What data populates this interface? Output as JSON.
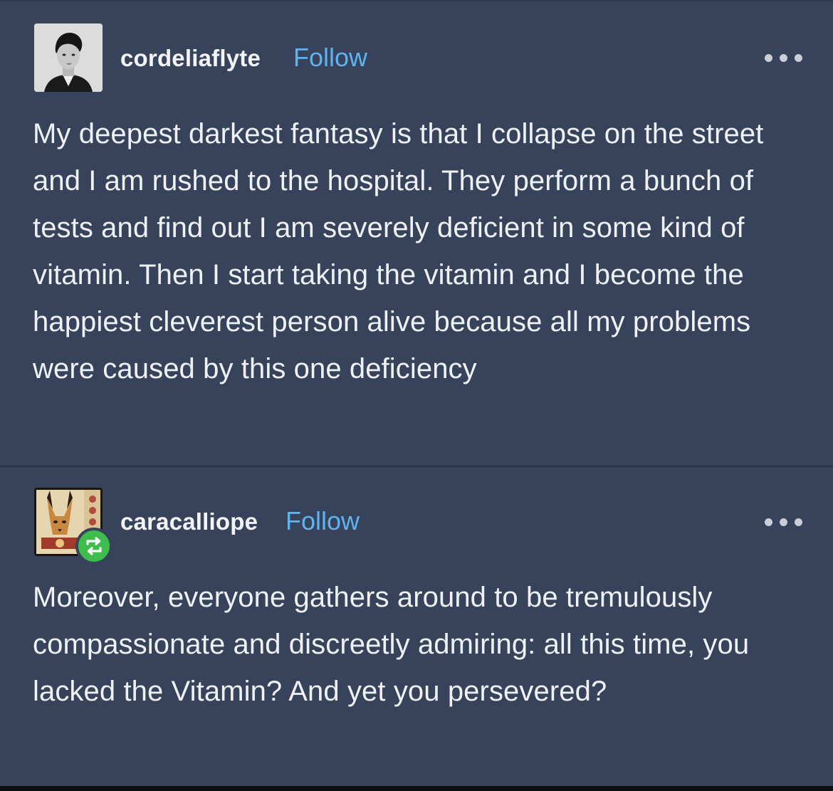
{
  "posts": [
    {
      "username": "cordeliaflyte",
      "follow_label": "Follow",
      "avatar_icon": "portrait-avatar",
      "more_icon": "more-options-icon",
      "body": "My deepest darkest fantasy is that I collapse on the street and I am rushed to the hospital. They perform a bunch of tests and find out I am severely deficient in some kind of vitamin. Then I start taking the vitamin and I become the happiest cleverest person alive because all my problems were caused by this one deficiency"
    },
    {
      "username": "caracalliope",
      "follow_label": "Follow",
      "avatar_icon": "caracal-art-avatar",
      "badge_icon": "reblog-icon",
      "more_icon": "more-options-icon",
      "body": "Moreover, everyone gathers around to be tremulously compassionate and discreetly admiring: all this time, you lacked the Vitamin? And yet you persevered?"
    }
  ],
  "colors": {
    "background": "#37435a",
    "text": "#eef1f5",
    "follow": "#5fb3ef",
    "reblog_badge": "#3fbd4c"
  }
}
